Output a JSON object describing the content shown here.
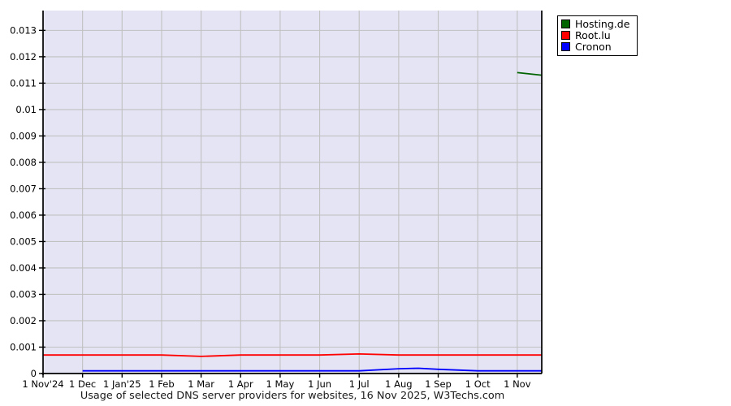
{
  "page": {
    "background": "#ffffff"
  },
  "title": {
    "text": "Usage of selected DNS server providers for websites, 16 Nov 2025, W3Techs.com"
  },
  "legend": {
    "position": "top-right",
    "items": [
      {
        "label": "Hosting.de",
        "color": "#006400"
      },
      {
        "label": "Root.lu",
        "color": "#ff0000"
      },
      {
        "label": "Cronon",
        "color": "#0000ff"
      }
    ]
  },
  "chart_data": {
    "type": "line",
    "title": "Usage of selected DNS server providers for websites, 16 Nov 2025, W3Techs.com",
    "xlabel": "",
    "ylabel": "",
    "plot_bg": "#e4e4f4",
    "grid_color": "#c1c1c1",
    "axis_color": "#000000",
    "grid": true,
    "legend_position": "top-right",
    "x_unit": "months since 1 Nov 2024",
    "xlim_months": [
      0,
      12.62
    ],
    "ylim": [
      0,
      0.01375
    ],
    "y_ticks": [
      0,
      0.001,
      0.002,
      0.003,
      0.004,
      0.005,
      0.006,
      0.007,
      0.008,
      0.009,
      0.01,
      0.011,
      0.012,
      0.013
    ],
    "x_ticks": [
      {
        "m": 0,
        "label": "1 Nov'24"
      },
      {
        "m": 1,
        "label": "1 Dec"
      },
      {
        "m": 2,
        "label": "1 Jan'25"
      },
      {
        "m": 3,
        "label": "1 Feb"
      },
      {
        "m": 4,
        "label": "1 Mar"
      },
      {
        "m": 5,
        "label": "1 Apr"
      },
      {
        "m": 6,
        "label": "1 May"
      },
      {
        "m": 7,
        "label": "1 Jun"
      },
      {
        "m": 8,
        "label": "1 Jul"
      },
      {
        "m": 9,
        "label": "1 Aug"
      },
      {
        "m": 10,
        "label": "1 Sep"
      },
      {
        "m": 11,
        "label": "1 Oct"
      },
      {
        "m": 12,
        "label": "1 Nov"
      }
    ],
    "series": [
      {
        "name": "Hosting.de",
        "color": "#006400",
        "note": "no visible usage until 1 Nov 2025, then jumps to ~0.0114%",
        "points": [
          {
            "m": 12,
            "v": 0.0114
          },
          {
            "m": 12.62,
            "v": 0.0113
          }
        ]
      },
      {
        "name": "Root.lu",
        "color": "#ff0000",
        "note": "roughly constant ~0.0007% with slight dip around Mar 2025 and slight rise around Jul 2025",
        "points": [
          {
            "m": 0,
            "v": 0.0007
          },
          {
            "m": 1,
            "v": 0.0007
          },
          {
            "m": 2,
            "v": 0.0007
          },
          {
            "m": 3,
            "v": 0.0007
          },
          {
            "m": 4,
            "v": 0.00065
          },
          {
            "m": 5,
            "v": 0.0007
          },
          {
            "m": 6,
            "v": 0.0007
          },
          {
            "m": 7,
            "v": 0.0007
          },
          {
            "m": 8,
            "v": 0.00074
          },
          {
            "m": 9,
            "v": 0.0007
          },
          {
            "m": 10,
            "v": 0.0007
          },
          {
            "m": 11,
            "v": 0.0007
          },
          {
            "m": 12,
            "v": 0.0007
          },
          {
            "m": 12.62,
            "v": 0.0007
          }
        ]
      },
      {
        "name": "Cronon",
        "color": "#0000ff",
        "note": "starts 1 Dec 2024 at ~0.0001%, small bump Aug-Sep 2025",
        "points": [
          {
            "m": 1,
            "v": 0.0001
          },
          {
            "m": 2,
            "v": 0.0001
          },
          {
            "m": 3,
            "v": 0.0001
          },
          {
            "m": 4,
            "v": 0.0001
          },
          {
            "m": 5,
            "v": 0.0001
          },
          {
            "m": 6,
            "v": 0.0001
          },
          {
            "m": 7,
            "v": 0.0001
          },
          {
            "m": 8,
            "v": 0.0001
          },
          {
            "m": 9,
            "v": 0.00018
          },
          {
            "m": 9.5,
            "v": 0.0002
          },
          {
            "m": 10,
            "v": 0.00016
          },
          {
            "m": 11,
            "v": 0.0001
          },
          {
            "m": 12,
            "v": 0.0001
          },
          {
            "m": 12.62,
            "v": 0.0001
          }
        ]
      }
    ]
  }
}
